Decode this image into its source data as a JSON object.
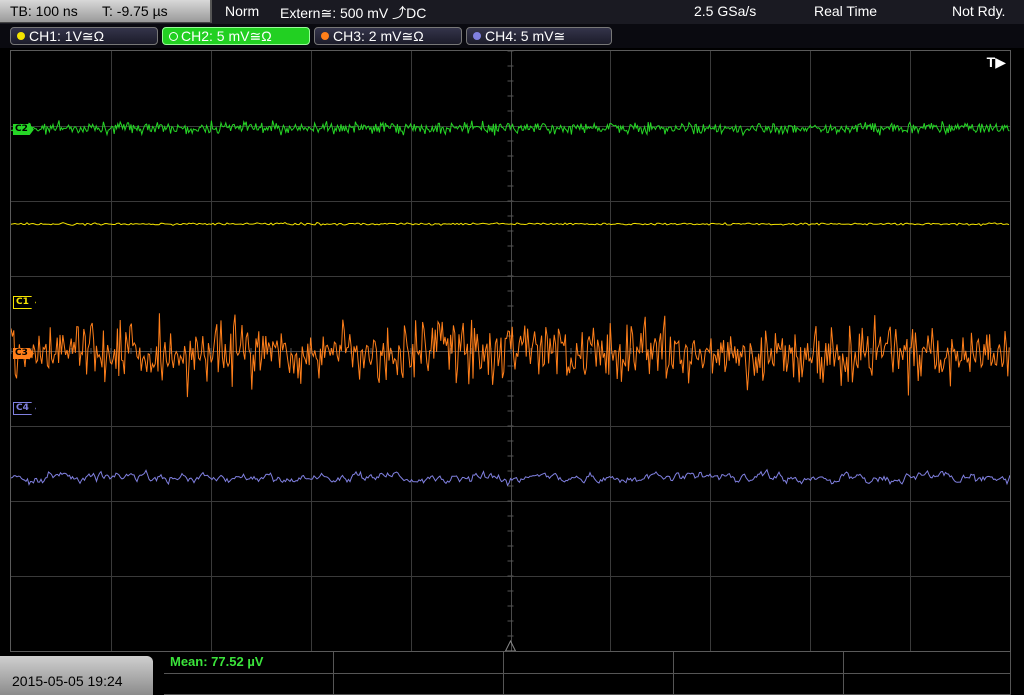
{
  "status": {
    "timebase": "TB: 100 ns",
    "trigger_time": "T: -9.75 µs",
    "mode": "Norm",
    "trigger_source": "Extern≅: 500 mV ⤴DC",
    "sample_rate": "2.5 GSa/s",
    "acq_mode": "Real Time",
    "state": "Not Rdy."
  },
  "channels": [
    {
      "label": "CH1: 1V≅Ω",
      "color": "#f5e400",
      "marker": "C1"
    },
    {
      "label": "CH2: 5 mV≅Ω",
      "color": "#26d626",
      "marker": "C2"
    },
    {
      "label": "CH3: 2 mV≅Ω",
      "color": "#ff7f1a",
      "marker": "C3"
    },
    {
      "label": "CH4: 5 mV≅",
      "color": "#8080e0",
      "marker": "C4"
    }
  ],
  "trigger_indicator": "T▶",
  "timestamp": "2015-05-05 19:24",
  "measurement": {
    "mean": "Mean: 77.52 µV"
  }
}
